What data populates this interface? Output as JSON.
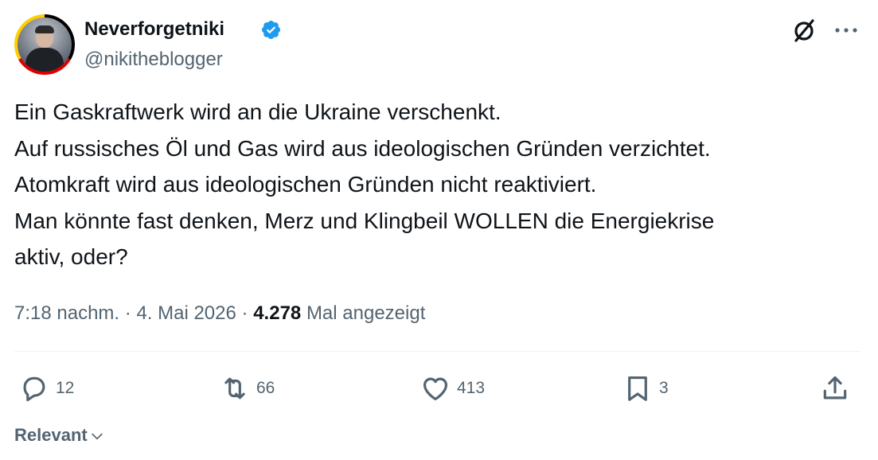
{
  "author": {
    "display_name": "Neverforgetniki",
    "handle": "@nikitheblogger",
    "verified": true
  },
  "header_icons": [
    "grok-icon",
    "more-icon"
  ],
  "tweet": {
    "lines": [
      "Ein Gaskraftwerk wird an die Ukraine verschenkt.",
      "Auf russisches Öl und Gas wird aus ideologischen Gründen verzichtet.",
      "Atomkraft wird aus ideologischen Gründen nicht reaktiviert.",
      "Man könnte fast denken, Merz und Klingbeil WOLLEN die Energiekrise",
      "aktiv, oder?"
    ]
  },
  "meta": {
    "time": "7:18 nachm.",
    "separator": "·",
    "date": "4. Mai 2026",
    "views_count": "4.278",
    "views_label": "Mal angezeigt"
  },
  "actions": {
    "replies": "12",
    "reposts": "66",
    "likes": "413",
    "bookmarks": "3"
  },
  "sort": {
    "label": "Relevant"
  },
  "colors": {
    "text": "#0f1419",
    "secondary": "#536471",
    "verified": "#1d9bf0",
    "divider": "#eff3f4"
  }
}
